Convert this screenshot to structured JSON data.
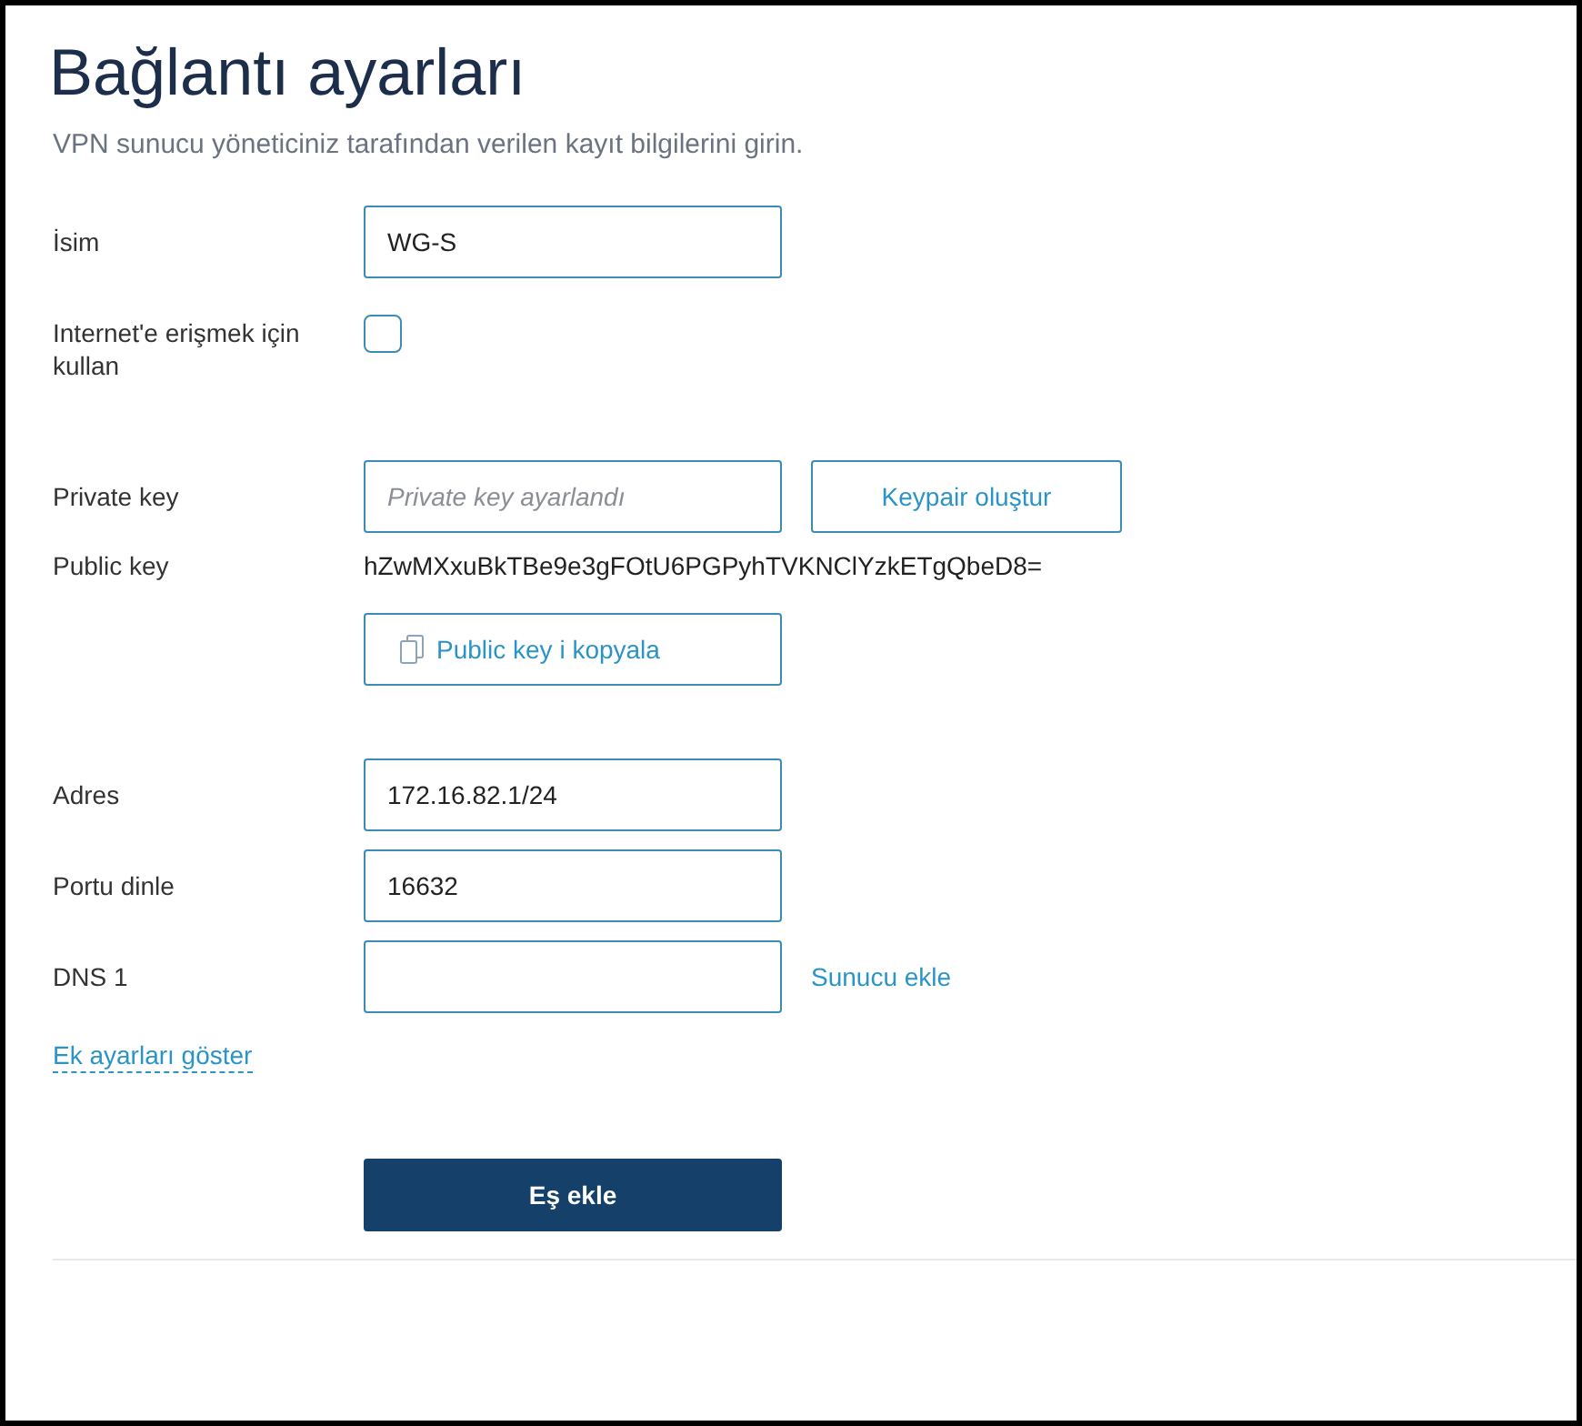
{
  "title": "Bağlantı ayarları",
  "description": "VPN sunucu yöneticiniz tarafından verilen kayıt bilgilerini girin.",
  "groups": [
    {
      "fields": [
        {
          "kind": "text",
          "label": "İsim",
          "value": "WG-S"
        },
        {
          "kind": "checkbox",
          "label": "Internet'e erişmek için kullan",
          "checked": false
        }
      ]
    },
    {
      "fields": [
        {
          "kind": "text",
          "label": "Private key",
          "placeholder": "Private key ayarlandı",
          "button": "Keypair oluştur"
        },
        {
          "kind": "display",
          "label": "Public key",
          "value": "hZwMXxuBkTBe9e3gFOtU6PGPyhTVKNClYzkETgQbeD8=",
          "button": "Public key i kopyala"
        }
      ]
    },
    {
      "fields": [
        {
          "kind": "text",
          "label": "Adres",
          "value": "172.16.82.1/24"
        },
        {
          "kind": "text",
          "label": "Portu dinle",
          "value": "16632"
        },
        {
          "kind": "text",
          "label": "DNS 1",
          "link": "Sunucu ekle"
        }
      ]
    }
  ],
  "advanced_link": "Ek ayarları göster",
  "submit_button": "Eş ekle"
}
